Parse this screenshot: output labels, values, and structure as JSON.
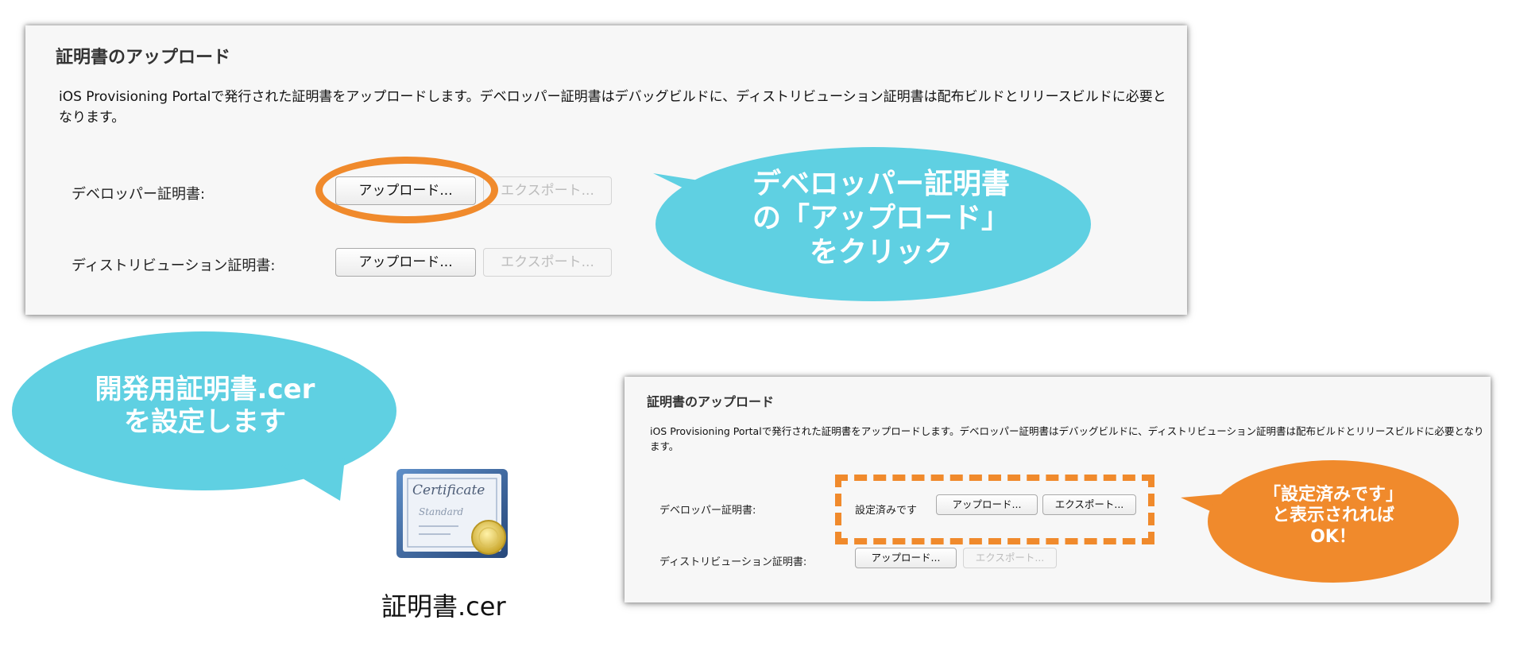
{
  "panel_top": {
    "title": "証明書のアップロード",
    "description": "iOS Provisioning Portalで発行された証明書をアップロードします。デベロッパー証明書はデバッグビルドに、ディストリビューション証明書は配布ビルドとリリースビルドに必要となります。",
    "rows": [
      {
        "label": "デベロッパー証明書:",
        "upload": "アップロード...",
        "export": "エクスポート..."
      },
      {
        "label": "ディストリビューション証明書:",
        "upload": "アップロード...",
        "export": "エクスポート..."
      }
    ]
  },
  "panel_bottom": {
    "title": "証明書のアップロード",
    "description": "iOS Provisioning Portalで発行された証明書をアップロードします。デベロッパー証明書はデバッグビルドに、ディストリビューション証明書は配布ビルドとリリースビルドに必要となります。",
    "rows": [
      {
        "label": "デベロッパー証明書:",
        "status": "設定済みです",
        "upload": "アップロード...",
        "export": "エクスポート..."
      },
      {
        "label": "ディストリビューション証明書:",
        "upload": "アップロード...",
        "export": "エクスポート..."
      }
    ]
  },
  "callouts": {
    "upload_click": "デベロッパー証明書\nの「アップロード」\nをクリック",
    "set_cert": "開発用証明書.cer\nを設定します",
    "ok": "「設定済みです」\nと表示されれば\nOK！"
  },
  "certificate_file": {
    "name": "証明書.cer",
    "icon_text_1": "Certificate",
    "icon_text_2": "Standard"
  },
  "colors": {
    "callout_blue": "#5fd0e2",
    "callout_orange": "#f08a2c",
    "highlight": "#f08a2c"
  }
}
